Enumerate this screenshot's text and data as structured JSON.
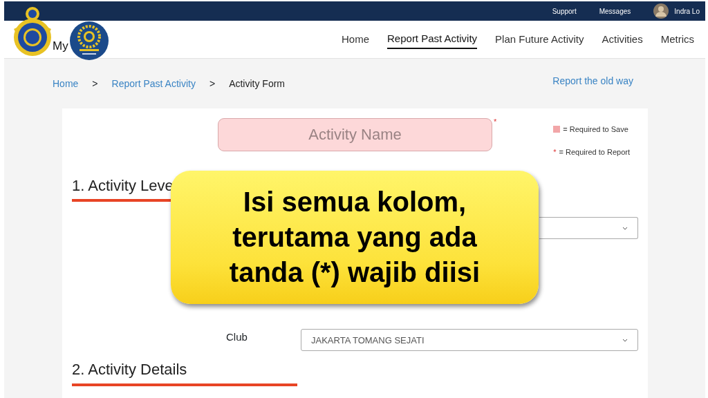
{
  "top_bar": {
    "links": [
      "Support",
      "Messages"
    ],
    "user": "Indra Lo"
  },
  "brand": {
    "text": "My"
  },
  "nav": [
    {
      "label": "Home",
      "selected": false
    },
    {
      "label": "Report Past Activity",
      "selected": true
    },
    {
      "label": "Plan Future Activity",
      "selected": false
    },
    {
      "label": "Activities",
      "selected": false
    },
    {
      "label": "Metrics",
      "selected": false
    }
  ],
  "breadcrumb": [
    {
      "label": "Home",
      "kind": "link"
    },
    {
      "label": ">",
      "kind": "separator"
    },
    {
      "label": "Report Past Activity",
      "kind": "link"
    },
    {
      "label": ">",
      "kind": "separator"
    },
    {
      "label": "Activity Form",
      "kind": "current"
    }
  ],
  "report_link": "Report the old way",
  "activity_name": {
    "placeholder": "Activity Name",
    "required_mark": "*"
  },
  "legend": [
    {
      "kind": "swatch",
      "text": "= Required to Save"
    },
    {
      "kind": "asterisk",
      "mark": "*",
      "text": "= Required to Report"
    }
  ],
  "section_1": {
    "title": "1. Activity Leve"
  },
  "club": {
    "label": "Club",
    "value": "JAKARTA TOMANG SEJATI"
  },
  "section_2": {
    "title": "2. Activity Details"
  },
  "callout": {
    "lines": [
      "Isi semua kolom,",
      "terutama yang ada",
      "tanda (*) wajib diisi"
    ]
  }
}
